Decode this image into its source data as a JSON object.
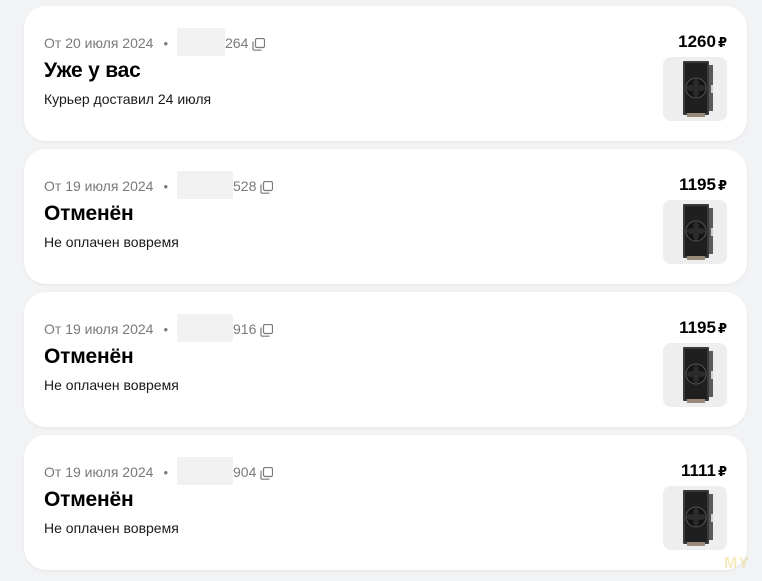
{
  "currency_symbol": "₽",
  "orders": [
    {
      "date": "От 20 июля 2024",
      "separator": "•",
      "number_visible": "264",
      "status": "Уже у вас",
      "status_detail": "Курьер доставил 24 июля",
      "price": "1260",
      "product_icon": "cpu-cooler-thumbnail"
    },
    {
      "date": "От 19 июля 2024",
      "separator": "•",
      "number_visible": "528",
      "status": "Отменён",
      "status_detail": "Не оплачен вовремя",
      "price": "1195",
      "product_icon": "cpu-cooler-thumbnail"
    },
    {
      "date": "От 19 июля 2024",
      "separator": "•",
      "number_visible": "916",
      "status": "Отменён",
      "status_detail": "Не оплачен вовремя",
      "price": "1195",
      "product_icon": "cpu-cooler-thumbnail"
    },
    {
      "date": "От 19 июля 2024",
      "separator": "•",
      "number_visible": "904",
      "status": "Отменён",
      "status_detail": "Не оплачен вовремя",
      "price": "1111",
      "product_icon": "cpu-cooler-thumbnail"
    }
  ],
  "watermark": "MY"
}
